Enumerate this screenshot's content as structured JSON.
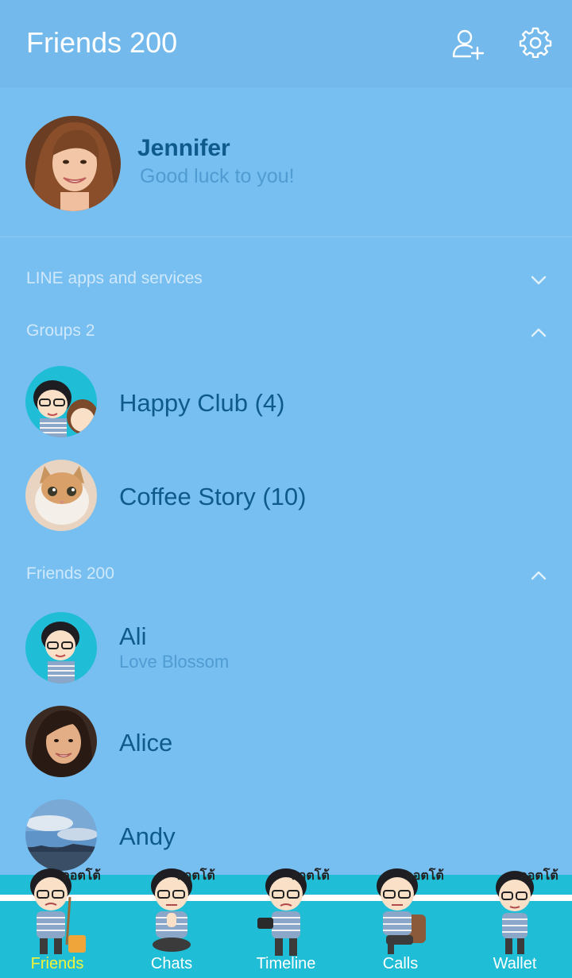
{
  "header": {
    "title": "Friends 200",
    "add_friend_icon": "person-plus-icon",
    "settings_icon": "gear-icon"
  },
  "profile": {
    "name": "Jennifer",
    "status": "Good luck to you!"
  },
  "sections": {
    "apps": {
      "label": "LINE apps and services",
      "expanded": false
    },
    "groups": {
      "label": "Groups 2",
      "expanded": true
    },
    "friends": {
      "label": "Friends 200",
      "expanded": true
    }
  },
  "groups": [
    {
      "name": "Happy Club (4)"
    },
    {
      "name": "Coffee Story (10)"
    }
  ],
  "friends": [
    {
      "name": "Ali",
      "status": "Love Blossom"
    },
    {
      "name": "Alice",
      "status": ""
    },
    {
      "name": "Andy",
      "status": ""
    }
  ],
  "tabs": [
    {
      "label": "Friends",
      "sticker": "ลอตโต้",
      "active": true
    },
    {
      "label": "Chats",
      "sticker": "ลอตโต้",
      "active": false
    },
    {
      "label": "Timeline",
      "sticker": "ลอตโต้",
      "active": false
    },
    {
      "label": "Calls",
      "sticker": "ลอตโต้",
      "active": false
    },
    {
      "label": "Wallet",
      "sticker": "ลอตโต้",
      "active": false
    }
  ],
  "colors": {
    "background": "#77bff0",
    "header": "#74b9ec",
    "name_text": "#0f5a8c",
    "status_text": "#4f9bd2",
    "tabbar": "#1fbdd6",
    "active_tab": "#f4f33a"
  }
}
